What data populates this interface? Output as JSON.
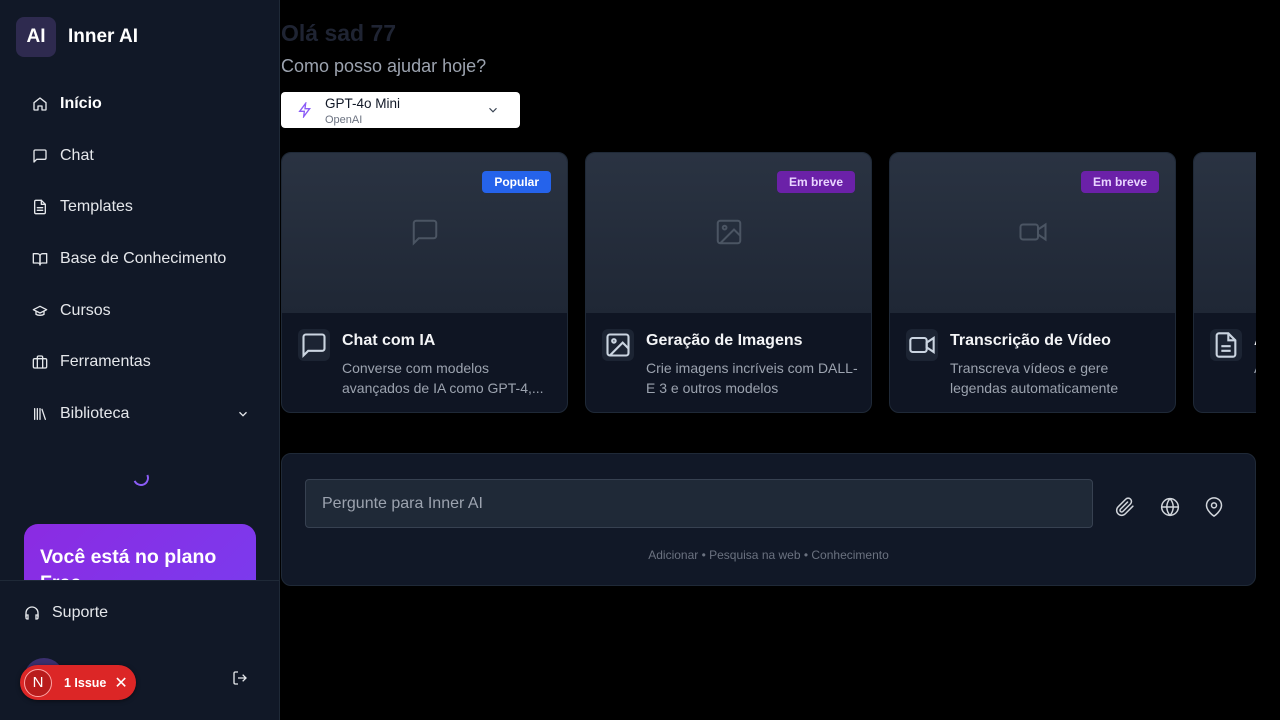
{
  "sidebar": {
    "brand_logo": "AI",
    "brand_name": "Inner AI",
    "items": [
      {
        "label": "Início",
        "icon": "home-icon"
      },
      {
        "label": "Chat",
        "icon": "message-icon"
      },
      {
        "label": "Templates",
        "icon": "file-text-icon"
      },
      {
        "label": "Base de Conhecimento",
        "icon": "book-open-icon"
      },
      {
        "label": "Cursos",
        "icon": "graduation-cap-icon"
      },
      {
        "label": "Ferramentas",
        "icon": "briefcase-icon"
      },
      {
        "label": "Biblioteca",
        "icon": "library-icon"
      }
    ],
    "plan_text": "Você está no plano Free",
    "support_label": "Suporte",
    "user_name": "Olá sad 77"
  },
  "issue_badge": {
    "letter": "N",
    "label": "1 Issue",
    "close": "✕"
  },
  "main": {
    "greeting": "Olá sad 77",
    "subtitle": "Como posso ajudar hoje?",
    "model": {
      "name": "GPT-4o Mini",
      "provider": "OpenAI"
    },
    "cards": [
      {
        "title": "Chat com IA",
        "desc": "Converse com modelos avançados de IA como GPT-4,...",
        "badge": "Popular",
        "badge_color": "#2563eb",
        "icon": "message-square-icon"
      },
      {
        "title": "Geração de Imagens",
        "desc": "Crie imagens incríveis com DALL-E 3 e outros modelos",
        "badge": "Em breve",
        "badge_color": "#6b21a8",
        "icon": "image-icon"
      },
      {
        "title": "Transcrição de Vídeo",
        "desc": "Transcreva vídeos e gere legendas automaticamente",
        "badge": "Em breve",
        "badge_color": "#6b21a8",
        "icon": "video-icon"
      },
      {
        "title": "A",
        "desc": "A",
        "badge": "",
        "icon": "document-icon"
      }
    ],
    "composer": {
      "placeholder": "Pergunte para Inner AI",
      "hint": "Adicionar • Pesquisa na web • Conhecimento"
    }
  },
  "colors": {
    "accent": "#8b5cf6",
    "background": "#000000",
    "sidebar": "#111827"
  }
}
